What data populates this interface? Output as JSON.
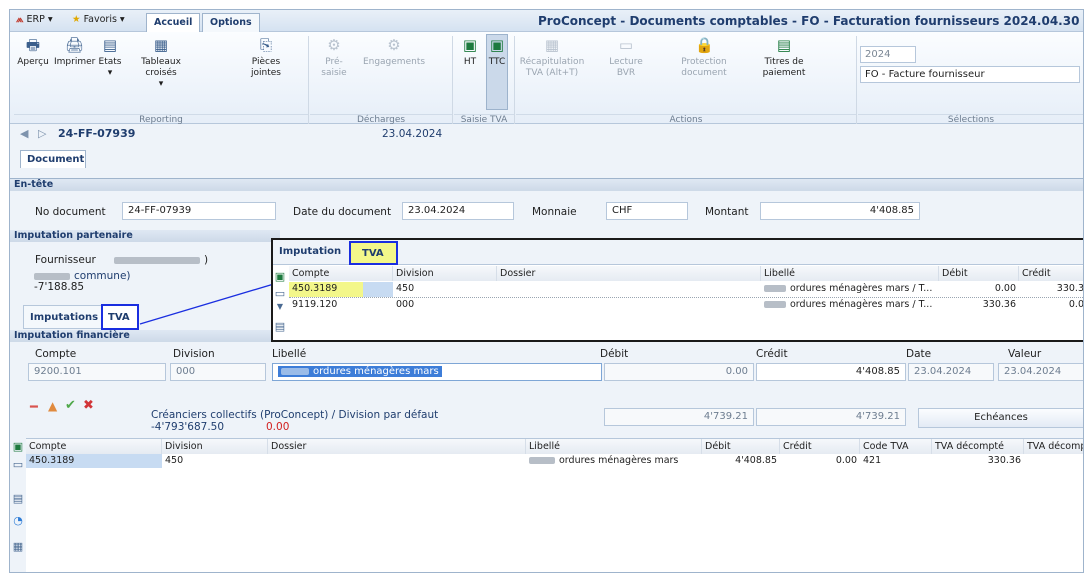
{
  "topbar": {
    "erp_label": "ERP ▾",
    "favoris_label": "Favoris ▾",
    "tabs": [
      {
        "label": "Accueil"
      },
      {
        "label": "Options"
      }
    ],
    "window_title": "ProConcept - Documents comptables - FO - Facturation fournisseurs 2024.04.30"
  },
  "ribbon": {
    "buttons": {
      "apercu": "Aperçu",
      "imprimer": "Imprimer",
      "etats": "Etats",
      "tableaux": "Tableaux croisés",
      "pieces_1": "Pièces",
      "pieces_2": "jointes",
      "presaisie_1": "Pré-",
      "presaisie_2": "saisie",
      "engagements": "Engagements",
      "ht": "HT",
      "ttc": "TTC",
      "recap_1": "Récapitulation",
      "recap_2": "TVA (Alt+T)",
      "lecture_1": "Lecture",
      "lecture_2": "BVR",
      "protection_1": "Protection",
      "protection_2": "document",
      "titres_1": "Titres de",
      "titres_2": "paiement"
    },
    "groups": {
      "reporting": "Reporting",
      "decharges": "Décharges",
      "saisie_tva": "Saisie TVA",
      "actions": "Actions",
      "selections": "Sélections"
    },
    "selections": {
      "year": "2024",
      "doc_type": "FO - Facture fournisseur"
    }
  },
  "nav": {
    "doc_number": "24-FF-07939",
    "doc_date": "23.04.2024",
    "tab_document": "Document"
  },
  "entete": {
    "header": "En-tête",
    "no_document_label": "No document",
    "no_document_value": "24-FF-07939",
    "date_label": "Date du document",
    "date_value": "23.04.2024",
    "monnaie_label": "Monnaie",
    "monnaie_value": "CHF",
    "montant_label": "Montant",
    "montant_value": "4'408.85"
  },
  "partenaire": {
    "header": "Imputation partenaire",
    "fournisseur_label": "Fournisseur",
    "fournisseur_suffix": ")",
    "commune_suffix": "commune)",
    "balance": "-7'188.85"
  },
  "lower_tabs": {
    "imputations": "Imputations",
    "tva": "TVA"
  },
  "popup": {
    "tab_imputation": "Imputation",
    "tab_tva": "TVA",
    "columns": [
      "Compte",
      "Division",
      "Dossier",
      "Libellé",
      "Débit",
      "Crédit"
    ],
    "rows": [
      {
        "compte": "450.3189",
        "division": "450",
        "dossier": "",
        "libelle": "ordures ménagères mars / T...",
        "debit": "0.00",
        "credit": "330.3"
      },
      {
        "compte": "9119.120",
        "division": "000",
        "dossier": "",
        "libelle": "ordures ménagères mars / T...",
        "debit": "330.36",
        "credit": "0.0"
      }
    ]
  },
  "financiere": {
    "header": "Imputation financière",
    "labels": {
      "compte": "Compte",
      "division": "Division",
      "libelle": "Libellé",
      "debit": "Débit",
      "credit": "Crédit",
      "date": "Date",
      "valeur": "Valeur"
    },
    "values": {
      "compte": "9200.101",
      "division": "000",
      "libelle": "ordures ménagères mars",
      "debit": "0.00",
      "credit": "4'408.85",
      "date": "23.04.2024",
      "valeur": "23.04.2024"
    },
    "creanciers": "Créanciers collectifs (ProConcept) / Division par défaut",
    "creanciers_balance": "-4'793'687.50",
    "creanciers_diff": "0.00",
    "total_debit": "4'739.21",
    "total_credit": "4'739.21",
    "echeances": "Echéances"
  },
  "grid": {
    "columns": [
      "Compte",
      "Division",
      "Dossier",
      "Libellé",
      "Débit",
      "Crédit",
      "Code TVA",
      "TVA décompté",
      "TVA décomp"
    ],
    "rows": [
      {
        "compte": "450.3189",
        "division": "450",
        "dossier": "",
        "libelle": "ordures ménagères mars",
        "debit": "4'408.85",
        "credit": "0.00",
        "code_tva": "421",
        "tva_decompte": "330.36",
        "tva_decomp": ""
      }
    ]
  },
  "colors": {
    "accent": "#1f3d6e",
    "highlight_yellow": "#f3f78a",
    "highlight_border": "#1a2ee0",
    "credit_red": "#d21f1f"
  }
}
